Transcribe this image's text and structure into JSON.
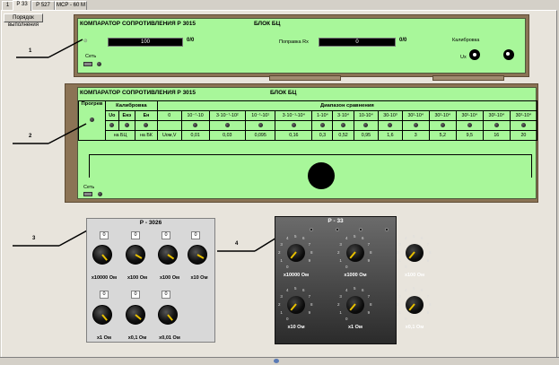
{
  "tabs": [
    "1",
    "Р 33",
    "Р 527",
    "МСР - 60 М"
  ],
  "toolbar": {
    "order_button": "Порядок выполнения"
  },
  "panel1": {
    "title": "КОМПАРАТОР СОПРОТИВЛЕНИЯ Р 3015",
    "block": "БЛОК БЦ",
    "display1": "100",
    "unit1": "0/0",
    "correction_label": "Поправка Rx",
    "display2": "0",
    "unit2": "0/0",
    "calibration_label": "Калибровка",
    "ux_label": "Ux",
    "power_label": "Сеть"
  },
  "panel2": {
    "title": "КОМПАРАТОР СОПРОТИВЛЕНИЯ Р 3015",
    "block": "БЛОК БЦ",
    "warmup": "Прогрев",
    "calibration": "Калибровка",
    "range_header": "Диапазон сравнения",
    "cal_cols": [
      "Uo",
      "Eнэ",
      "Eн"
    ],
    "range_cols": [
      "0",
      "10⁻⁷-10",
      "3·10⁻⁷-10²",
      "10⁻¹-10¹",
      "3·10⁻¹-10⁴",
      "1-10⁴",
      "3·10⁴",
      "10-10⁴",
      "30-10³",
      "30²-10⁴",
      "30²-10⁴",
      "30²-10⁴",
      "30²-10⁴",
      "30²-10⁴"
    ],
    "bottom_cal": [
      "на БЦ",
      "на БК"
    ],
    "row_label": "Uoм,V",
    "values": [
      "0,01",
      "0,03",
      "0,095",
      "0,16",
      "0,3",
      "0,52",
      "0,95",
      "1,6",
      "3",
      "5,2",
      "9,5",
      "16",
      "20"
    ],
    "power_label": "Сеть"
  },
  "diag_labels": [
    "1",
    "2",
    "3",
    "4"
  ],
  "r3026": {
    "title": "Р - 3026",
    "boxes": [
      "0",
      "0",
      "0",
      "0",
      "0",
      "0",
      "0"
    ],
    "knobs": [
      "х10000 Ом",
      "х100 Ом",
      "х100 Ом",
      "х10 Ом",
      "х1 Ом",
      "х0,1 Ом",
      "х0,01 Ом"
    ]
  },
  "r33": {
    "title": "Р - 33",
    "dials": [
      "х10000 Ом",
      "х1000 Ом",
      "х100 Ом",
      "х10 Ом",
      "х1 Ом",
      "х0,1 Ом"
    ]
  }
}
